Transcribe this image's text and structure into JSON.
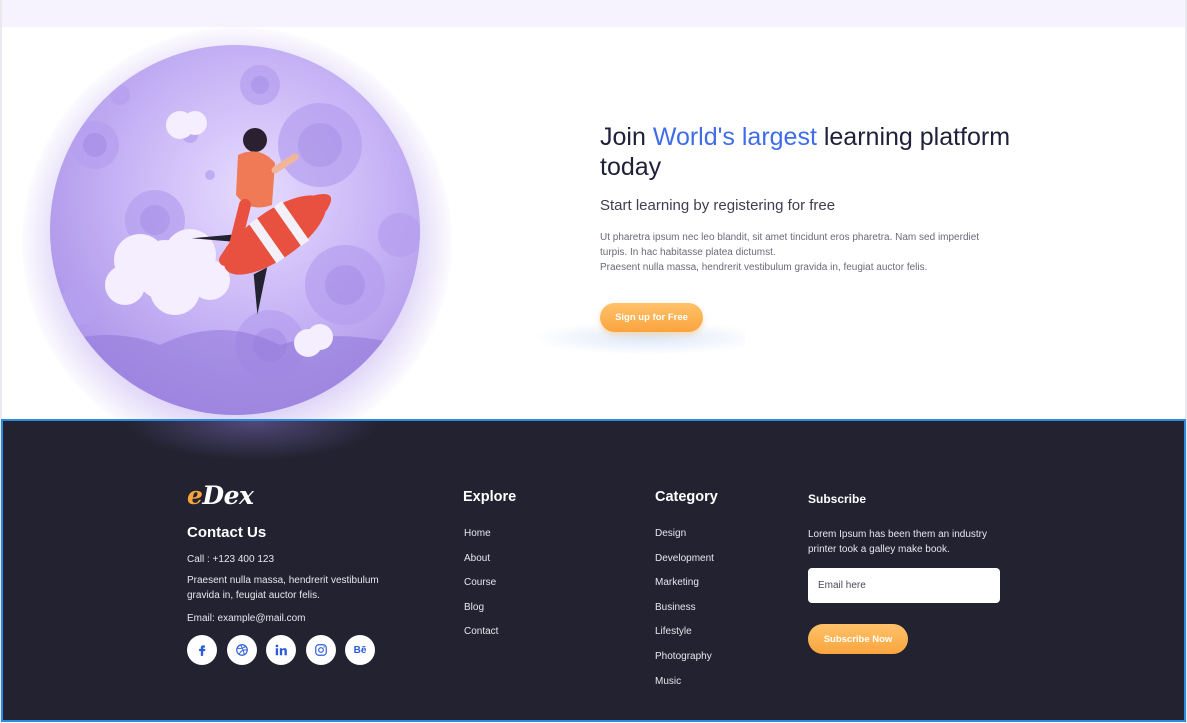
{
  "hero": {
    "title_prefix": "Join ",
    "title_accent": "World's largest",
    "title_suffix": " learning platform today",
    "subtitle": "Start learning by registering for free",
    "body_line1": "Ut pharetra ipsum nec leo blandit, sit amet tincidunt eros pharetra. Nam sed imperdiet turpis. In hac habitasse platea dictumst.",
    "body_line2": "Praesent nulla massa, hendrerit vestibulum gravida in, feugiat auctor felis.",
    "signup_label": "Sign up for Free",
    "illustration_icon": "rocket-rider-illustration",
    "accent_color": "#3f6de8",
    "button_color": "#f9a53e"
  },
  "footer": {
    "logo_e": "e",
    "logo_rest": "Dex",
    "contact": {
      "title": "Contact Us",
      "call": "Call : +123 400 123",
      "address": "Praesent nulla massa, hendrerit vestibulum gravida in, feugiat auctor felis.",
      "email": "Email: example@mail.com"
    },
    "socials": [
      {
        "icon": "facebook-icon"
      },
      {
        "icon": "dribbble-icon"
      },
      {
        "icon": "linkedin-icon"
      },
      {
        "icon": "instagram-icon"
      },
      {
        "icon": "behance-icon",
        "text": "Bē"
      }
    ],
    "explore": {
      "title": "Explore",
      "items": [
        "Home",
        "About",
        "Course",
        "Blog",
        "Contact"
      ]
    },
    "category": {
      "title": "Category",
      "items": [
        "Design",
        "Development",
        "Marketing",
        "Business",
        "Lifestyle",
        "Photography",
        "Music"
      ]
    },
    "subscribe": {
      "title": "Subscribe",
      "text": "Lorem Ipsum has been them an industry printer took a galley make book.",
      "email_placeholder": "Email here",
      "button_label": "Subscribe Now"
    },
    "background_color": "#222230",
    "border_color": "#2b8be0"
  }
}
